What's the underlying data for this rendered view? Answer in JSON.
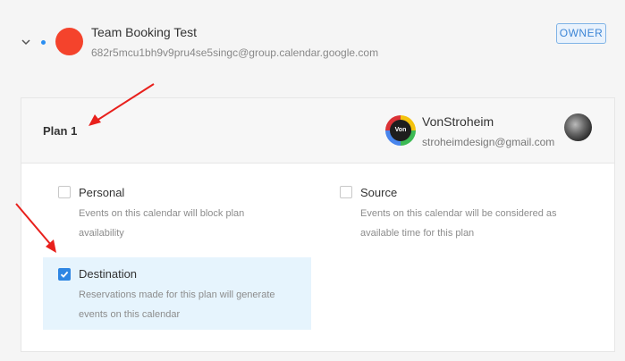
{
  "calendar": {
    "name": "Team Booking Test",
    "email": "682r5mcu1bh9v9pru4se5singc@group.calendar.google.com",
    "role_badge": "OWNER",
    "color": "#f4432c"
  },
  "plan": {
    "title": "Plan 1",
    "owner": {
      "avatar_label": "Von",
      "name": "VonStroheim",
      "email": "stroheimdesign@gmail.com"
    },
    "options": [
      {
        "label": "Personal",
        "description": "Events on this calendar will block plan availability",
        "checked": false
      },
      {
        "label": "Source",
        "description": "Events on this calendar will be considered as available time for this plan",
        "checked": false
      },
      {
        "label": "Destination",
        "description": "Reservations made for this plan will generate events on this calendar",
        "checked": true
      }
    ]
  },
  "colors": {
    "accent": "#2e86e3",
    "selected_bg": "#e6f4fd",
    "annotation_arrow": "#e8201c"
  }
}
